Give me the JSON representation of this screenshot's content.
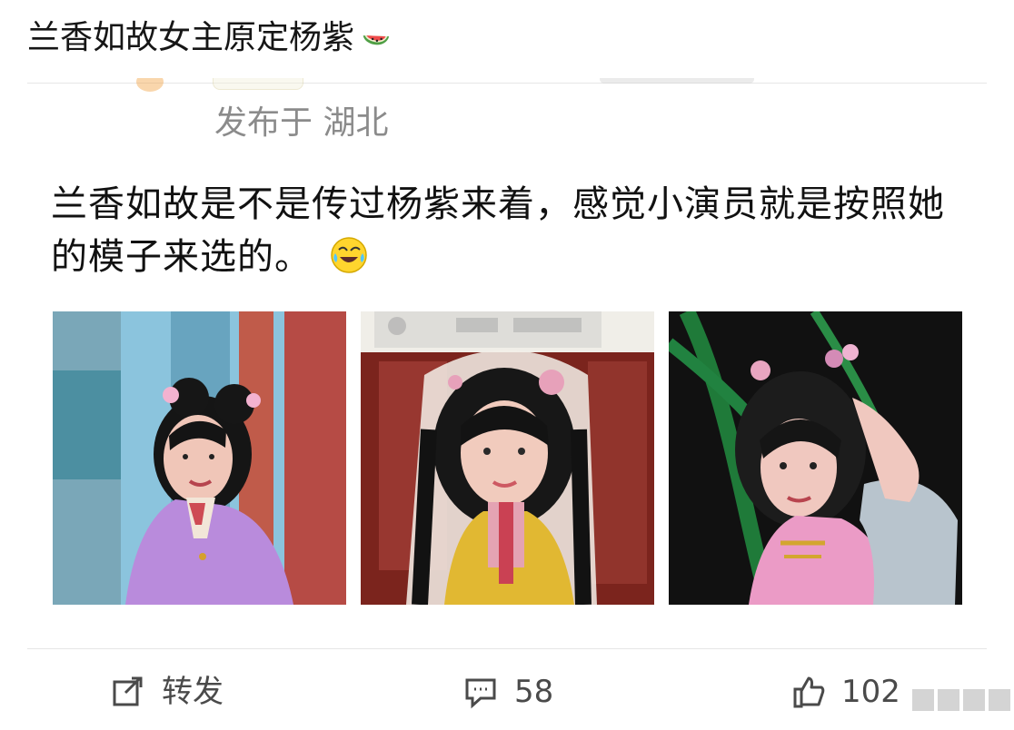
{
  "topic": {
    "title": "兰香如故女主原定杨紫"
  },
  "post": {
    "location": "发布于 湖北",
    "text": "兰香如故是不是传过杨紫来着，感觉小演员就是按照她的模子来选的。",
    "images": [
      {
        "name": "photo-1"
      },
      {
        "name": "photo-2"
      },
      {
        "name": "photo-3"
      }
    ]
  },
  "actions": {
    "repost_label": "转发",
    "comment_count": "58",
    "like_count": "102"
  },
  "colors": {
    "text": "#111111",
    "secondary": "#8b8b8b",
    "divider": "#e6e6e6",
    "icon": "#4a4a4a"
  },
  "icons": {
    "topic": "watermelon-icon",
    "text": "laughing-icon",
    "repost": "share-icon",
    "comment": "comment-icon",
    "like": "like-icon"
  }
}
